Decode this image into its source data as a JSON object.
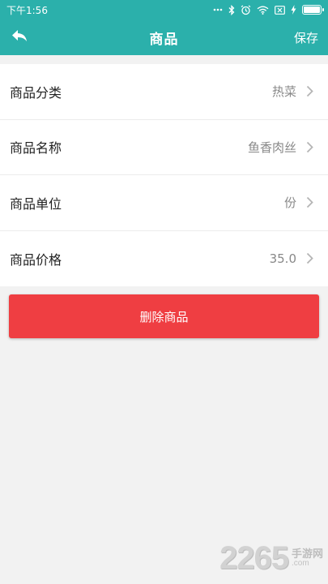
{
  "status_bar": {
    "time": "下午1:56",
    "icons": [
      "dots-icon",
      "bluetooth-icon",
      "alarm-icon",
      "wifi-icon",
      "sim-icon",
      "charging-icon",
      "battery-icon"
    ]
  },
  "nav": {
    "back_icon": "back-arrow-icon",
    "title": "商品",
    "save_label": "保存"
  },
  "form": {
    "rows": [
      {
        "label": "商品分类",
        "value": "热菜"
      },
      {
        "label": "商品名称",
        "value": "鱼香肉丝"
      },
      {
        "label": "商品单位",
        "value": "份"
      },
      {
        "label": "商品价格",
        "value": "35.0"
      }
    ]
  },
  "actions": {
    "delete_label": "删除商品"
  },
  "watermark": {
    "number": "2265",
    "cn": "手游网",
    "com": ".com"
  },
  "colors": {
    "primary": "#2bb0ab",
    "danger": "#ef3e42",
    "background": "#f2f2f2"
  }
}
